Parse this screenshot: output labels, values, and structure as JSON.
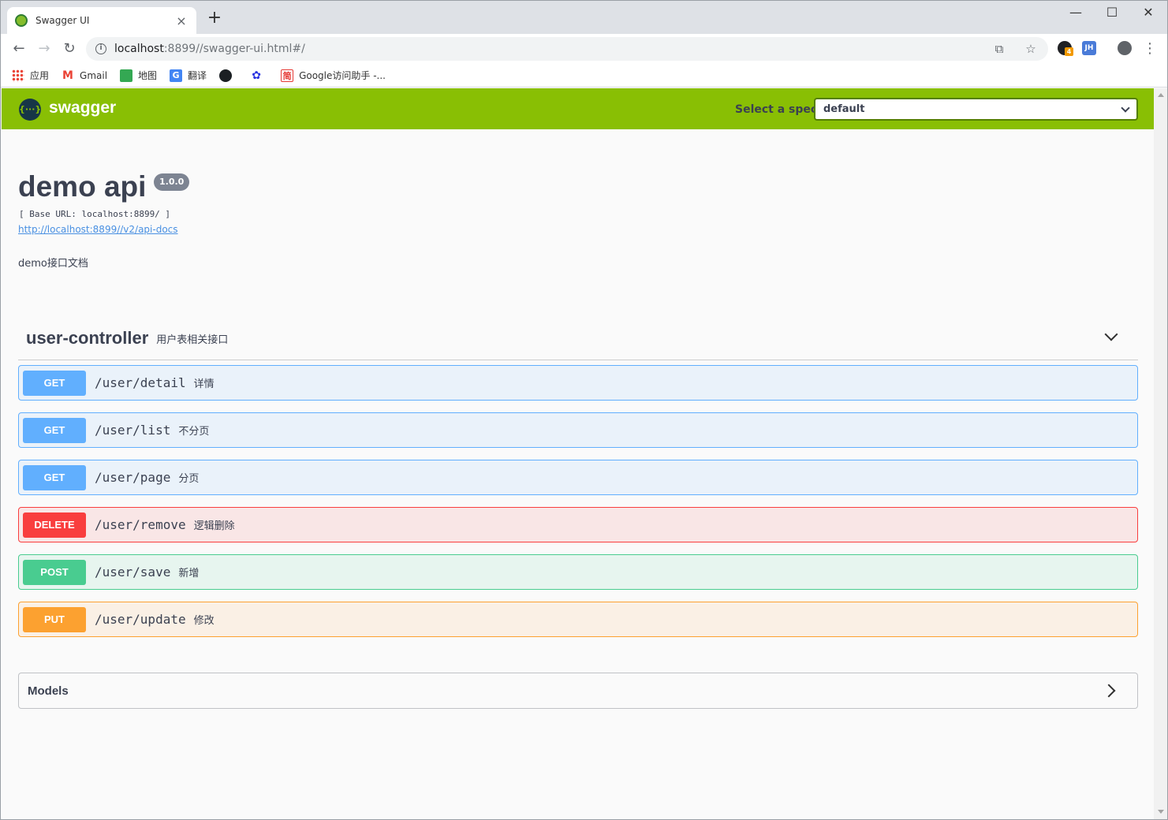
{
  "browser": {
    "tab_title": "Swagger UI",
    "tab_close": "×",
    "new_tab": "+",
    "window_min": "—",
    "window_max": "☐",
    "window_close": "✕",
    "url_host": "localhost",
    "url_rest": ":8899//swagger-ui.html#/",
    "ext_jh_label": "JH",
    "ext_badge": "4",
    "bookmarks": [
      {
        "label": "应用",
        "icon": "apps-grid-icon"
      },
      {
        "label": "Gmail",
        "icon": "gmail-icon"
      },
      {
        "label": "地图",
        "icon": "maps-icon"
      },
      {
        "label": "翻译",
        "icon": "translate-icon"
      },
      {
        "label": "",
        "icon": "github-icon"
      },
      {
        "label": "",
        "icon": "baidu-icon"
      },
      {
        "label": "Google访问助手 -...",
        "icon": "jian-icon",
        "glyph": "简"
      }
    ]
  },
  "swagger": {
    "brand": "swagger",
    "logo_glyph": "{···}",
    "spec_label": "Select a spec",
    "spec_value": "default",
    "title": "demo api",
    "version": "1.0.0",
    "base_url": "[ Base URL: localhost:8899/ ]",
    "docs_link": "http://localhost:8899//v2/api-docs",
    "description": "demo接口文档",
    "tag": {
      "name": "user-controller",
      "description": "用户表相关接口"
    },
    "operations": [
      {
        "method": "GET",
        "path": "/user/detail",
        "summary": "详情"
      },
      {
        "method": "GET",
        "path": "/user/list",
        "summary": "不分页"
      },
      {
        "method": "GET",
        "path": "/user/page",
        "summary": "分页"
      },
      {
        "method": "DELETE",
        "path": "/user/remove",
        "summary": "逻辑删除"
      },
      {
        "method": "POST",
        "path": "/user/save",
        "summary": "新增"
      },
      {
        "method": "PUT",
        "path": "/user/update",
        "summary": "修改"
      }
    ],
    "models_title": "Models"
  },
  "colors": {
    "header_green": "#89bf04",
    "get": "#61affe",
    "delete": "#f93e3e",
    "post": "#49cc90",
    "put": "#fca130"
  }
}
